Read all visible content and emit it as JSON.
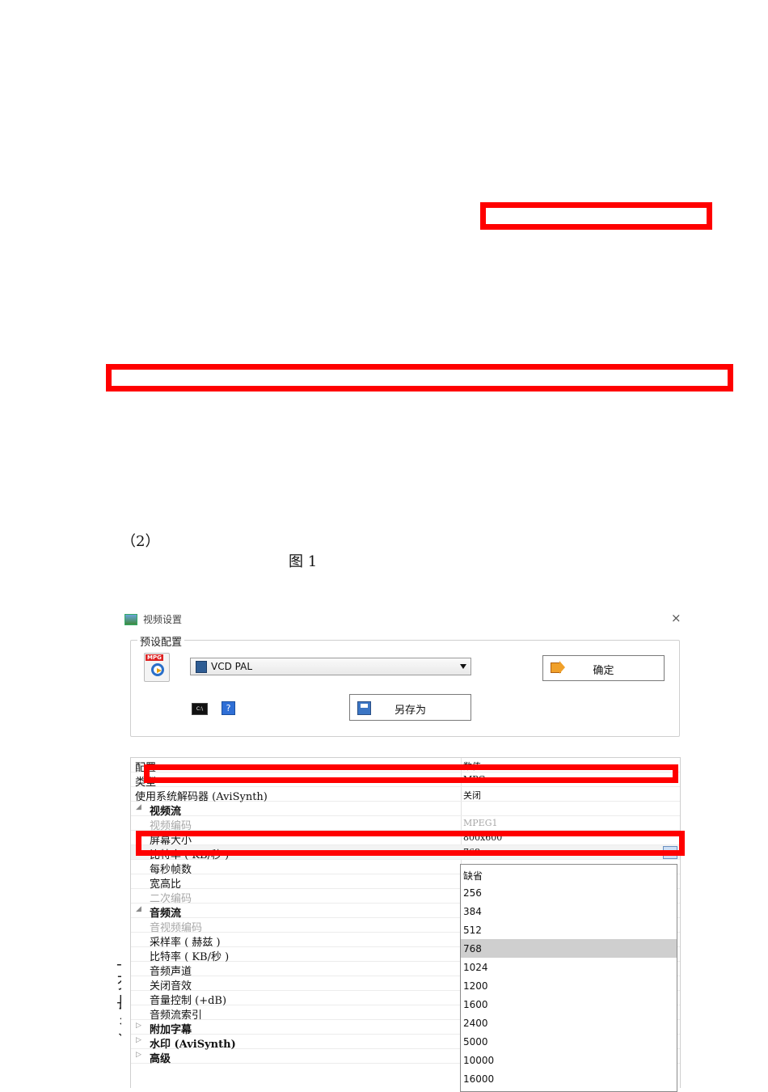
{
  "document": {
    "item_label": "（2）",
    "figure_caption": "图 1",
    "side_glyphs": [
      "-",
      "歹",
      "長",
      "彳",
      "丫"
    ]
  },
  "dialog": {
    "title": "视频设置",
    "close_symbol": "×",
    "preset_group_label": "预设配置",
    "preset_icon_tag": "MPG",
    "preset_value": "VCD PAL",
    "ok_button": "确定",
    "save_as_button": "另存为",
    "console_icon_text": "C:\\",
    "help_icon_text": "?"
  },
  "property_grid": {
    "header": {
      "name": "配置",
      "value": "数值"
    },
    "rows": [
      {
        "name": "类型",
        "value": "MPG"
      },
      {
        "name": "使用系统解码器 (AviSynth)",
        "value": "关闭"
      },
      {
        "name": "视频流",
        "value": ""
      },
      {
        "name": "视频编码",
        "value": "MPEG1"
      },
      {
        "name": "屏幕大小",
        "value": "800x600"
      },
      {
        "name": "比特率 ( KB/秒 )",
        "value": "768"
      },
      {
        "name": "每秒帧数",
        "value": ""
      },
      {
        "name": "宽高比",
        "value": ""
      },
      {
        "name": "二次编码",
        "value": ""
      },
      {
        "name": "音频流",
        "value": ""
      },
      {
        "name": "音视频编码",
        "value": ""
      },
      {
        "name": "采样率 ( 赫兹 )",
        "value": ""
      },
      {
        "name": "比特率 ( KB/秒 )",
        "value": ""
      },
      {
        "name": "音频声道",
        "value": ""
      },
      {
        "name": "关闭音效",
        "value": ""
      },
      {
        "name": "音量控制 (+dB)",
        "value": ""
      },
      {
        "name": "音频流索引",
        "value": ""
      },
      {
        "name": "附加字幕",
        "value": ""
      },
      {
        "name": "水印 (AviSynth)",
        "value": ""
      },
      {
        "name": "高级",
        "value": ""
      }
    ]
  },
  "bitrate_dropdown": {
    "options": [
      "缺省",
      "256",
      "384",
      "512",
      "768",
      "1024",
      "1200",
      "1600",
      "2400",
      "5000",
      "10000",
      "16000"
    ],
    "selected": "768"
  },
  "colors": {
    "highlight_box": "#ff0000",
    "selected_option": "#cfcfcf"
  }
}
